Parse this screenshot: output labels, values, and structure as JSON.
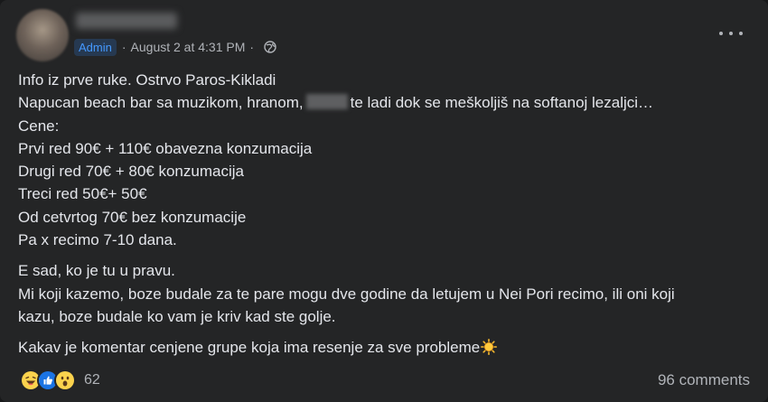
{
  "header": {
    "badge": "Admin",
    "timestamp": "August 2 at 4:31 PM",
    "separator": "·",
    "privacy_icon": "globe-icon",
    "more_icon": "more-options-icon"
  },
  "post": {
    "lines1": [
      "Info iz prve ruke. Ostrvo Paros-Kikladi",
      "Napucan beach bar sa muzikom, hranom,",
      "Cene:",
      "Prvi red 90€ + 110€ obavezna konzumacija",
      "Drugi red 70€ + 80€ konzumacija",
      "Treci red 50€+ 50€",
      "Od cetvrtog 70€ bez konzumacije",
      "Pa x recimo 7-10 dana."
    ],
    "line2_tail": "te ladi dok se meškoljiš na softanoj lezaljci…",
    "para2": [
      "E sad, ko je tu u pravu.",
      "Mi koji kazemo, boze budale za te pare mogu dve godine da letujem u Nei Pori recimo, ili oni koji",
      "kazu, boze budale ko vam je kriv kad ste golje."
    ],
    "para3": "Kakav je komentar cenjene grupe koja ima resenje za sve probleme",
    "emoji": "sun-emoji"
  },
  "footer": {
    "reaction_icons": [
      "haha-icon",
      "like-icon",
      "wow-icon"
    ],
    "reaction_count": "62",
    "comments": "96 comments"
  },
  "colors": {
    "background": "#242526",
    "text": "#e4e6eb",
    "secondary": "#b0b3b8",
    "badge_text": "#4599ff",
    "badge_bg": "#263951"
  }
}
